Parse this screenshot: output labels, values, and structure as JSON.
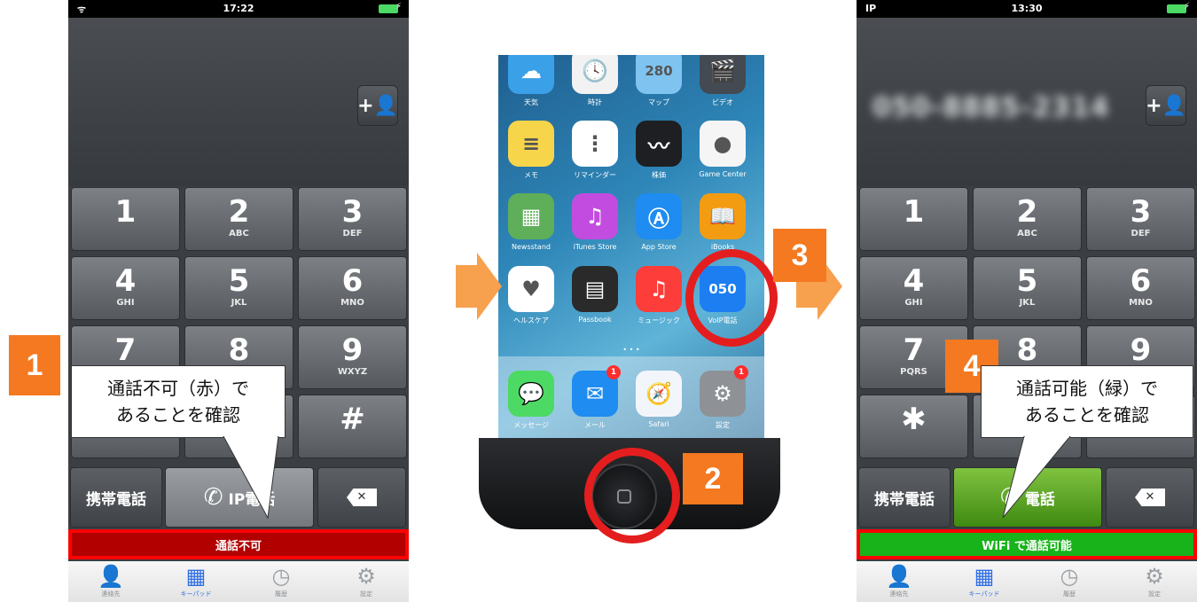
{
  "left_phone": {
    "status_bar": {
      "signal": "ᯤ",
      "time": "17:22"
    },
    "number": "",
    "add_contact_icon": "+👤",
    "keys": [
      {
        "digit": "1",
        "letters": ""
      },
      {
        "digit": "2",
        "letters": "ABC"
      },
      {
        "digit": "3",
        "letters": "DEF"
      },
      {
        "digit": "4",
        "letters": "GHI"
      },
      {
        "digit": "5",
        "letters": "JKL"
      },
      {
        "digit": "6",
        "letters": "MNO"
      },
      {
        "digit": "7",
        "letters": ""
      },
      {
        "digit": "8",
        "letters": ""
      },
      {
        "digit": "9",
        "letters": "WXYZ"
      },
      {
        "digit": "",
        "letters": ""
      },
      {
        "digit": "",
        "letters": ""
      },
      {
        "digit": "#",
        "letters": ""
      }
    ],
    "mobile_button": "携帯電話",
    "ip_button": "IP電話",
    "delete_icon": "✕",
    "status_strip": "通話不可",
    "strip_color": "#b20000",
    "tabs": [
      "連絡先",
      "キーパッド",
      "履歴",
      "設定"
    ]
  },
  "right_phone": {
    "status_bar": {
      "carrier": "IP",
      "time": "13:30"
    },
    "number": "050-8885-2314",
    "add_contact_icon": "+👤",
    "keys": [
      {
        "digit": "1",
        "letters": ""
      },
      {
        "digit": "2",
        "letters": "ABC"
      },
      {
        "digit": "3",
        "letters": "DEF"
      },
      {
        "digit": "4",
        "letters": "GHI"
      },
      {
        "digit": "5",
        "letters": "JKL"
      },
      {
        "digit": "6",
        "letters": "MNO"
      },
      {
        "digit": "7",
        "letters": "PQRS"
      },
      {
        "digit": "8",
        "letters": ""
      },
      {
        "digit": "9",
        "letters": ""
      },
      {
        "digit": "✱",
        "letters": ""
      },
      {
        "digit": "",
        "letters": ""
      },
      {
        "digit": "",
        "letters": ""
      }
    ],
    "mobile_button": "携帯電話",
    "ip_button": "電話",
    "delete_icon": "✕",
    "status_strip": "WiFi で通話可能",
    "strip_color": "#18b21a",
    "tabs": [
      "連絡先",
      "キーパッド",
      "履歴",
      "設定"
    ]
  },
  "home_screen": {
    "apps": [
      {
        "label": "天気",
        "glyph": "☁",
        "color": "#3aa0e8"
      },
      {
        "label": "時計",
        "glyph": "🕓",
        "color": "#f2f2f2"
      },
      {
        "label": "マップ",
        "glyph": "280",
        "color": "#7fc4f0"
      },
      {
        "label": "ビデオ",
        "glyph": "🎬",
        "color": "#444a52"
      },
      {
        "label": "メモ",
        "glyph": "≡",
        "color": "#f7d54a"
      },
      {
        "label": "リマインダー",
        "glyph": "⋮",
        "color": "#ffffff"
      },
      {
        "label": "株価",
        "glyph": "〰",
        "color": "#1e1f22"
      },
      {
        "label": "Game Center",
        "glyph": "●",
        "color": "#f5f5f5"
      },
      {
        "label": "Newsstand",
        "glyph": "▦",
        "color": "#5fae5a"
      },
      {
        "label": "iTunes Store",
        "glyph": "♫",
        "color": "#c24ce0"
      },
      {
        "label": "App Store",
        "glyph": "Ⓐ",
        "color": "#1e8cf0"
      },
      {
        "label": "iBooks",
        "glyph": "📖",
        "color": "#f39c12"
      },
      {
        "label": "ヘルスケア",
        "glyph": "♥",
        "color": "#ffffff"
      },
      {
        "label": "Passbook",
        "glyph": "▤",
        "color": "#2a2a2a"
      },
      {
        "label": "ミュージック",
        "glyph": "♫",
        "color": "#fc3d39"
      },
      {
        "label": "VoIP電話",
        "glyph": "050",
        "color": "#1d7ef2"
      }
    ],
    "dock": [
      {
        "label": "メッセージ",
        "glyph": "💬",
        "color": "#4cd964",
        "badge": ""
      },
      {
        "label": "メール",
        "glyph": "✉",
        "color": "#1e8cf0",
        "badge": "1"
      },
      {
        "label": "Safari",
        "glyph": "🧭",
        "color": "#f2f6fa",
        "badge": ""
      },
      {
        "label": "設定",
        "glyph": "⚙",
        "color": "#8e9297",
        "badge": "1"
      }
    ],
    "page_dots": "• • •"
  },
  "annotations": {
    "step1": "1",
    "step2": "2",
    "step3": "3",
    "step4": "4",
    "bubble_left": [
      "通話不可（赤）で",
      "あることを確認"
    ],
    "bubble_right": [
      "通話可能（緑）で",
      "あることを確認"
    ],
    "accent_orange": "#f47920",
    "ring_red": "#e41e1e"
  }
}
